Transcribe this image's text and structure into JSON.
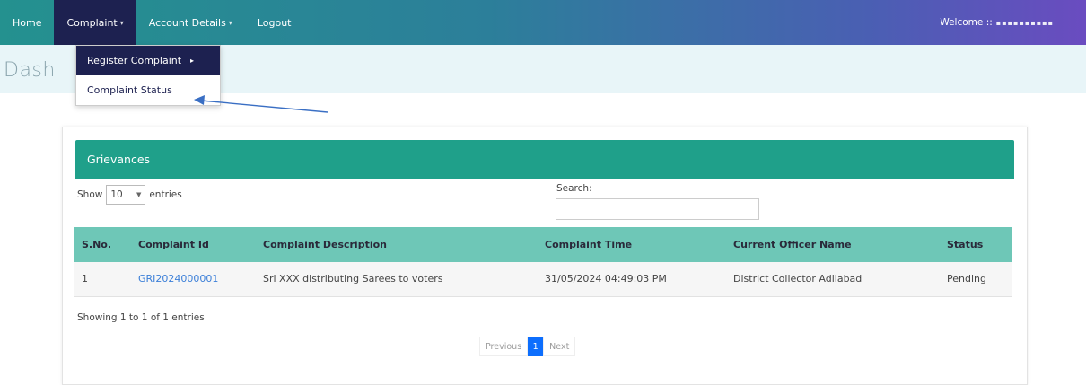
{
  "nav": {
    "home": "Home",
    "complaint": "Complaint",
    "account": "Account Details",
    "logout": "Logout",
    "caret": "▾",
    "welcome_label": "Welcome ::",
    "welcome_name": "▪▪▪▪▪▪▪▪▪▪"
  },
  "dropdown": {
    "register": "Register Complaint",
    "status": "Complaint Status",
    "caret": "▸"
  },
  "page_title": "Dash",
  "panel": {
    "title": "Grievances"
  },
  "table_controls": {
    "show": "Show",
    "length": "10",
    "entries": "entries",
    "search_label": "Search:",
    "info": "Showing 1 to 1 of 1 entries"
  },
  "table": {
    "headers": [
      "S.No.",
      "Complaint Id",
      "Complaint Description",
      "Complaint Time",
      "Current Officer Name",
      "Status"
    ],
    "rows": [
      [
        "1",
        "GRI2024000001",
        "Sri XXX distributing Sarees to voters",
        "31/05/2024 04:49:03 PM",
        "District Collector Adilabad",
        "Pending"
      ]
    ]
  },
  "pagination": {
    "previous": "Previous",
    "current": "1",
    "next": "Next"
  },
  "colors": {
    "nav_gradient_start": "#24918f",
    "nav_gradient_end": "#6a4cc0",
    "panel_header": "#1fa08a",
    "table_header": "#6ec7b7",
    "link": "#3b7fd8",
    "page_active": "#0d6efd"
  }
}
